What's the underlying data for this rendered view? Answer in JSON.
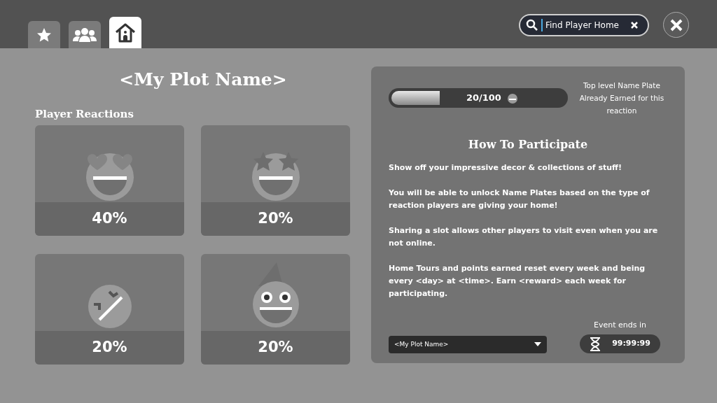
{
  "tabs": [
    {
      "kind": "star",
      "selected": false
    },
    {
      "kind": "group",
      "selected": false
    },
    {
      "kind": "home",
      "selected": true
    }
  ],
  "search": {
    "value": "Find Player Home"
  },
  "plot_title": "<My Plot Name>",
  "reactions_heading": "Player Reactions",
  "reactions": [
    {
      "kind": "heart_eyes",
      "percent": "40%"
    },
    {
      "kind": "star_eyes",
      "percent": "20%"
    },
    {
      "kind": "laughing",
      "percent": "20%"
    },
    {
      "kind": "wizard",
      "percent": "20%"
    }
  ],
  "progress": {
    "level": 0.28,
    "reading": "20/100"
  },
  "name_plate_note": "Top level Name Plate Already Earned for this reaction",
  "participate": {
    "title": "How To Participate",
    "paragraphs": [
      "Show off your impressive decor & collections of stuff!",
      "You will be able to unlock Name Plates based on the type of reaction players are giving your home!",
      "Sharing a slot allows other players to visit even when you are not online.",
      "Home Tours and points earned reset every week and being every <day> at <time>.  Earn <reward> each week for participating."
    ]
  },
  "plot_select": {
    "value": "<My Plot Name>"
  },
  "event": {
    "label": "Event ends in",
    "timer": "99:99:99"
  }
}
